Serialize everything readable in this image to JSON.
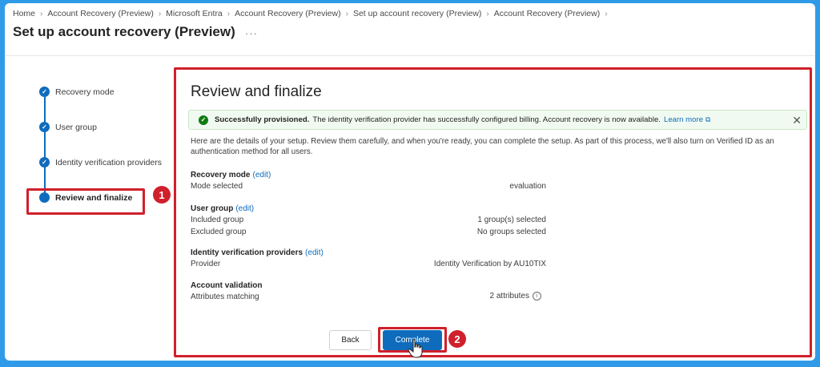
{
  "breadcrumb": [
    "Home",
    "Account Recovery (Preview)",
    "Microsoft Entra",
    "Account Recovery (Preview)",
    "Set up account recovery (Preview)",
    "Account Recovery (Preview)"
  ],
  "page_title": "Set up account recovery (Preview)",
  "more_label": "···",
  "steps": [
    {
      "label": "Recovery mode",
      "state": "completed"
    },
    {
      "label": "User group",
      "state": "completed"
    },
    {
      "label": "Identity verification providers",
      "state": "completed"
    },
    {
      "label": "Review and finalize",
      "state": "current"
    }
  ],
  "annotations": {
    "badge_1": "1",
    "badge_2": "2",
    "color": "#d0202b"
  },
  "main": {
    "title": "Review and finalize",
    "message": {
      "strong": "Successfully provisioned.",
      "text": "The identity verification provider has successfully configured billing. Account recovery is now available.",
      "link": "Learn more"
    },
    "description": "Here are the details of your setup. Review them carefully, and when you're ready, you can complete the setup. As part of this process, we'll also turn on Verified ID as an authentication method for all users.",
    "edit_label": "(edit)",
    "groups": [
      {
        "title": "Recovery mode",
        "editable": true,
        "rows": [
          {
            "label": "Mode selected",
            "value": "evaluation"
          }
        ]
      },
      {
        "title": "User group",
        "editable": true,
        "rows": [
          {
            "label": "Included group",
            "value": "1 group(s) selected"
          },
          {
            "label": "Excluded group",
            "value": "No groups selected"
          }
        ]
      },
      {
        "title": "Identity verification providers",
        "editable": true,
        "rows": [
          {
            "label": "Provider",
            "value": "Identity Verification by AU10TIX"
          }
        ]
      },
      {
        "title": "Account validation",
        "editable": false,
        "rows": [
          {
            "label": "Attributes matching",
            "value": "2 attributes"
          }
        ]
      }
    ]
  },
  "buttons": {
    "back": "Back",
    "complete": "Complete"
  },
  "colors": {
    "accent": "#0f6cbd",
    "success": "#107c10",
    "frame": "#2f9be8"
  }
}
